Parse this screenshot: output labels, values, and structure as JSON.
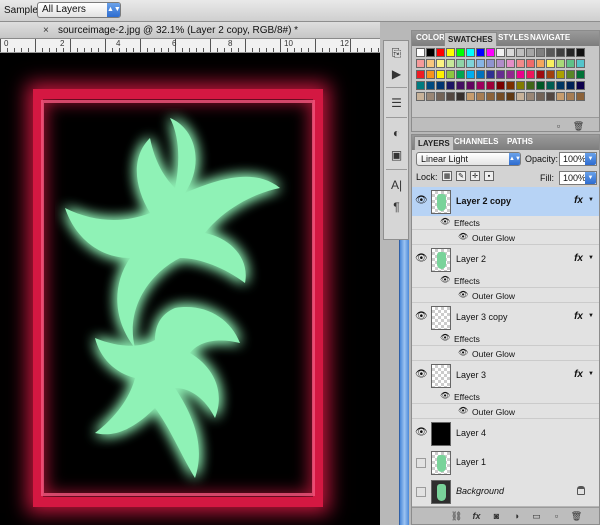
{
  "options_bar": {
    "sample_label": "Sample:",
    "sample_value": "All Layers"
  },
  "document": {
    "close_glyph": "×",
    "title": "sourceimage-2.jpg @ 32.1% (Layer 2 copy, RGB/8#) *"
  },
  "ruler": {
    "numbers": [
      "0",
      "2",
      "4",
      "6",
      "8",
      "10",
      "12"
    ]
  },
  "colors": {
    "frame": "#d41842",
    "glow": "#7ff0ad",
    "selected_layer": "#b7d3f5"
  },
  "swatches_panel": {
    "tabs": [
      "COLOR",
      "SWATCHES",
      "STYLES",
      "NAVIGATE"
    ],
    "active_tab": "SWATCHES",
    "colors": [
      "#ffffff",
      "#000000",
      "#ff0000",
      "#ffff00",
      "#00ff00",
      "#00ffff",
      "#0000ff",
      "#ff00ff",
      "#f2f2f2",
      "#d9d9d9",
      "#bfbfbf",
      "#a6a6a6",
      "#808080",
      "#595959",
      "#404040",
      "#262626",
      "#111111",
      "#f59a9a",
      "#f7c77e",
      "#fbf383",
      "#c6e79a",
      "#8fd3a7",
      "#7fd4d9",
      "#87b5e5",
      "#8f94cf",
      "#b08dc9",
      "#e48ec7",
      "#f18a8a",
      "#ee6a6a",
      "#f5a65c",
      "#f9ef5e",
      "#a9d878",
      "#5fc188",
      "#54c4cb",
      "#ee1c24",
      "#f7941d",
      "#fff200",
      "#8dc63f",
      "#00a651",
      "#00aeef",
      "#0072bc",
      "#2e3192",
      "#662d91",
      "#92278f",
      "#ec008c",
      "#ed145b",
      "#9e0b0f",
      "#a0410d",
      "#aba000",
      "#598527",
      "#007236",
      "#007b7f",
      "#004a80",
      "#003471",
      "#1b1464",
      "#440e62",
      "#630460",
      "#9e005d",
      "#9e0039",
      "#790000",
      "#7b2e00",
      "#827b00",
      "#406618",
      "#005826",
      "#005e52",
      "#003663",
      "#002157",
      "#0d004c",
      "#c7b299",
      "#998675",
      "#736357",
      "#534741",
      "#37302d",
      "#c69c6d",
      "#a67c52",
      "#8c6239",
      "#754c24",
      "#603913",
      "#c7b299",
      "#998675",
      "#736357",
      "#534741",
      "#c69c6d",
      "#a67c52",
      "#8c6239"
    ]
  },
  "layers_panel": {
    "tabs": [
      "LAYERS",
      "CHANNELS",
      "PATHS"
    ],
    "active_tab": "LAYERS",
    "blend_mode": "Linear Light",
    "opacity_label": "Opacity:",
    "opacity_value": "100%",
    "lock_label": "Lock:",
    "fill_label": "Fill:",
    "fill_value": "100%",
    "effects_label": "Effects",
    "outer_glow_label": "Outer Glow",
    "fx_label": "fx",
    "layers": [
      {
        "name": "Layer 2 copy",
        "visible": true,
        "selected": true,
        "fx": true,
        "thumb": "art"
      },
      {
        "name": "Layer 2",
        "visible": true,
        "selected": false,
        "fx": true,
        "thumb": "art"
      },
      {
        "name": "Layer 3 copy",
        "visible": true,
        "selected": false,
        "fx": true,
        "thumb": "empty"
      },
      {
        "name": "Layer 3",
        "visible": true,
        "selected": false,
        "fx": true,
        "thumb": "empty"
      },
      {
        "name": "Layer 4",
        "visible": true,
        "selected": false,
        "fx": false,
        "thumb": "black"
      },
      {
        "name": "Layer 1",
        "visible": false,
        "selected": false,
        "fx": false,
        "thumb": "art"
      },
      {
        "name": "Background",
        "visible": false,
        "selected": false,
        "fx": false,
        "thumb": "dark",
        "locked": true
      }
    ]
  }
}
